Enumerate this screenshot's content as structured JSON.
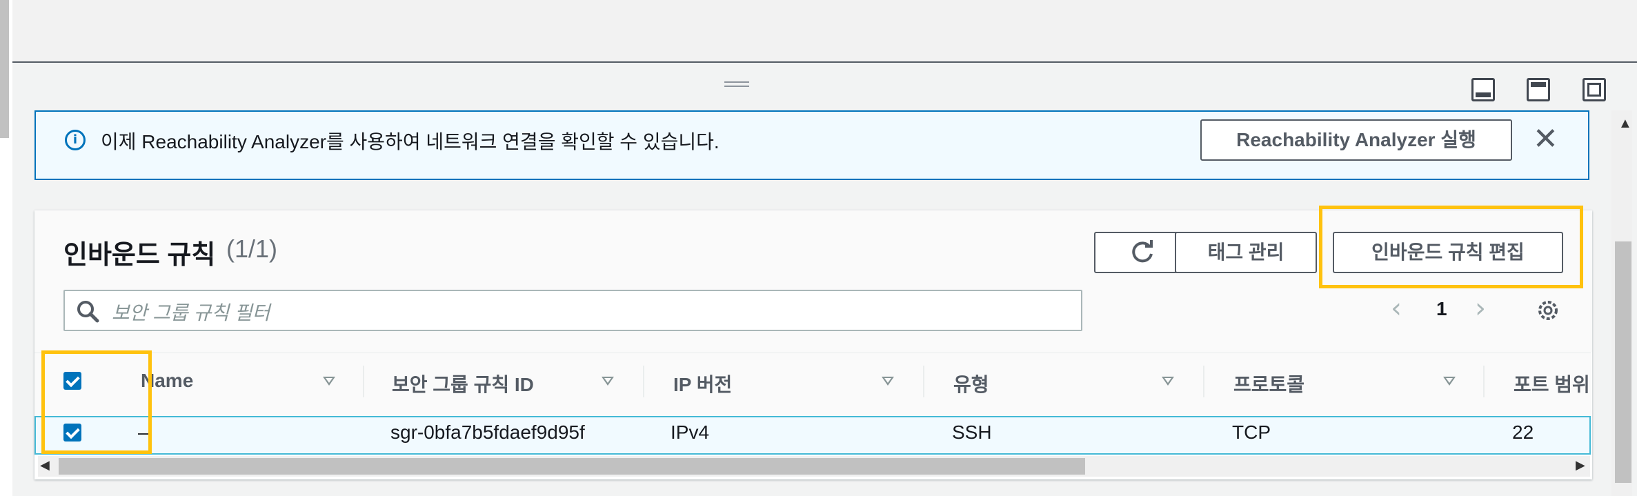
{
  "banner": {
    "text": "이제 Reachability Analyzer를 사용하여 네트워크 연결을 확인할 수 있습니다.",
    "button_label": "Reachability Analyzer 실행",
    "close_symbol": "✕"
  },
  "panel": {
    "title": "인바운드 규칙",
    "count": "(1/1)",
    "buttons": {
      "manage_tags": "태그 관리",
      "edit_rules": "인바운드 규칙 편집"
    },
    "search_placeholder": "보안 그룹 규칙 필터",
    "pagination": {
      "prev": "‹",
      "page": "1",
      "next": "›"
    }
  },
  "table": {
    "columns": [
      "Name",
      "보안 그룹 규칙 ID",
      "IP 버전",
      "유형",
      "프로토콜",
      "포트 범위"
    ],
    "rows": [
      {
        "selected": true,
        "name": "–",
        "rule_id": "sgr-0bfa7b5fdaef9d95f",
        "ip_version": "IPv4",
        "type": "SSH",
        "protocol": "TCP",
        "port_range": "22"
      }
    ],
    "select_all_checked": true
  },
  "colors": {
    "accent": "#0073bb",
    "highlight": "#ffc20e",
    "row_selected": "#f1faff"
  }
}
